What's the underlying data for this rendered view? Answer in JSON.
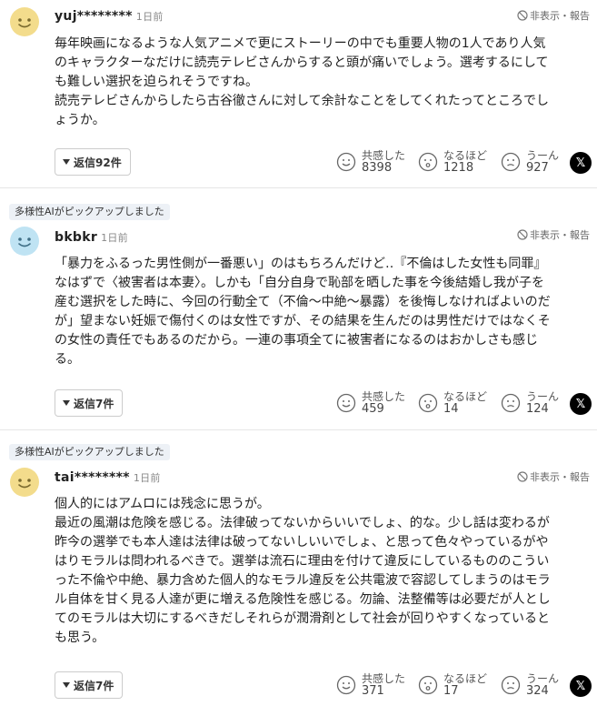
{
  "comments": [
    {
      "ai_badge": "",
      "username": "yuj********",
      "time": "1日前",
      "actions": "非表示・報告",
      "body": "毎年映画になるような人気アニメで更にストーリーの中でも重要人物の1人であり人気\nのキャラクターなだけに読売テレビさんからすると頭が痛いでしょう。選考するにして\nも難しい選択を迫られそうですね。\n読売テレビさんからしたら古谷徹さんに対して余計なことをしてくれたってところでし\nょうか。",
      "reply_label": "返信92件",
      "reactions": [
        {
          "label": "共感した",
          "count": "8398"
        },
        {
          "label": "なるほど",
          "count": "1218"
        },
        {
          "label": "うーん",
          "count": "927"
        }
      ],
      "avatar_color": "#f3dc8c",
      "face_color": "#7a6a2e"
    },
    {
      "ai_badge": "多様性AIがピックアップしました",
      "username": "bkbkr",
      "time": "1日前",
      "actions": "非表示・報告",
      "body": "「暴力をふるった男性側が一番悪い」のはもちろんだけど‥『不倫はした女性も同罪』\nなはずで〈被害者は本妻〉。しかも「自分自身で恥部を晒した事を今後結婚し我が子を\n産む選択をした時に、今回の行動全て（不倫〜中絶〜暴露）を後悔しなければよいのだ\nが」望まない妊娠で傷付くのは女性ですが、その結果を生んだのは男性だけではなくそ\nの女性の責任でもあるのだから。一連の事項全てに被害者になるのはおかしさも感じ\nる。",
      "reply_label": "返信7件",
      "reactions": [
        {
          "label": "共感した",
          "count": "459"
        },
        {
          "label": "なるほど",
          "count": "14"
        },
        {
          "label": "うーん",
          "count": "124"
        }
      ],
      "avatar_color": "#bfe3f3",
      "face_color": "#3f6f86"
    },
    {
      "ai_badge": "多様性AIがピックアップしました",
      "username": "tai********",
      "time": "1日前",
      "actions": "非表示・報告",
      "body": "個人的にはアムロには残念に思うが。\n最近の風潮は危険を感じる。法律破ってないからいいでしょ、的な。少し話は変わるが\n昨今の選挙でも本人達は法律は破ってないしいいでしょ、と思って色々やっているがや\nはりモラルは問われるべきで。選挙は流石に理由を付けて違反にしているもののこうい\nった不倫や中絶、暴力含めた個人的なモラル違反を公共電波で容認してしまうのはモラ\nル自体を甘く見る人達が更に増える危険性を感じる。勿論、法整備等は必要だが人とし\nてのモラルは大切にするべきだしそれらが潤滑剤として社会が回りやすくなっていると\nも思う。",
      "reply_label": "返信7件",
      "reactions": [
        {
          "label": "共感した",
          "count": "371"
        },
        {
          "label": "なるほど",
          "count": "17"
        },
        {
          "label": "うーん",
          "count": "324"
        }
      ],
      "avatar_color": "#f3dc8c",
      "face_color": "#7a6a2e"
    }
  ],
  "share_label": "𝕏"
}
